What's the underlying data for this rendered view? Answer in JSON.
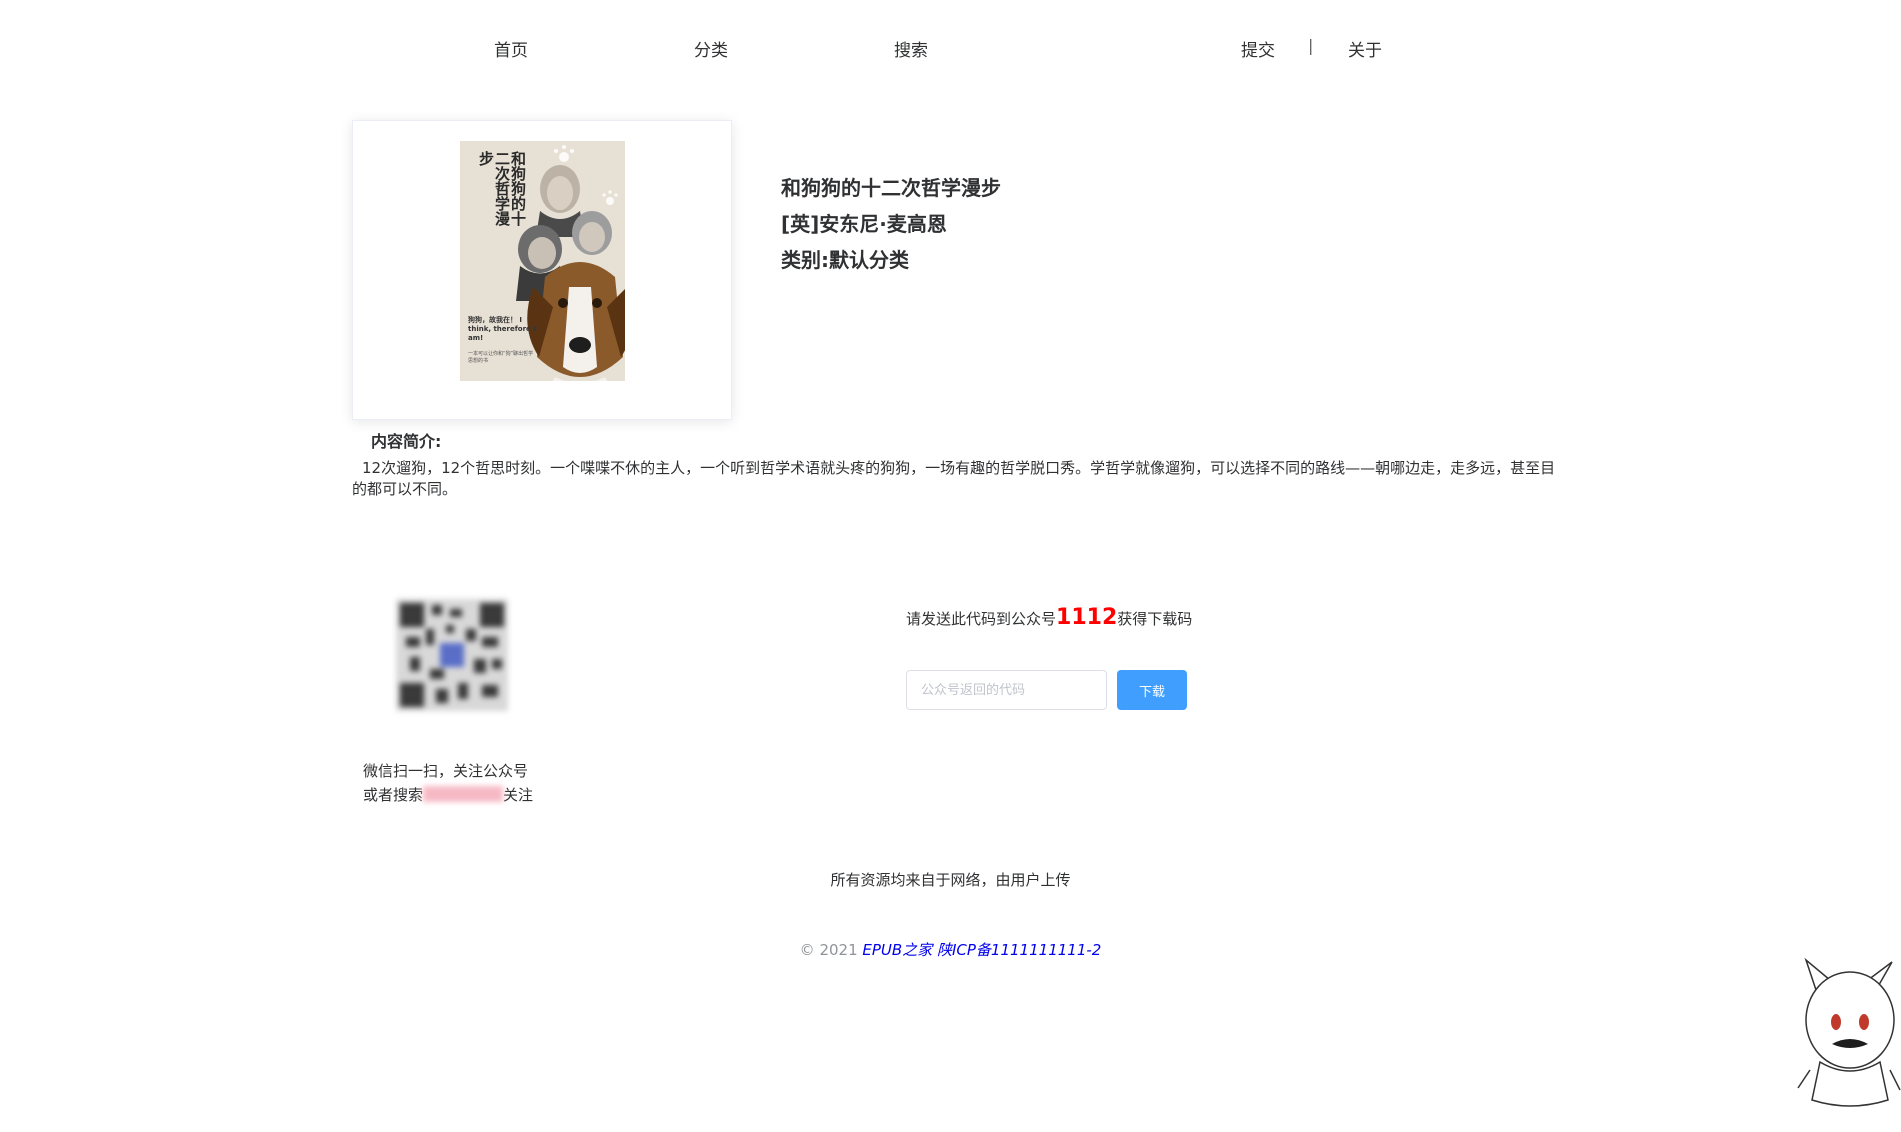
{
  "nav": {
    "home": "首页",
    "category": "分类",
    "search": "搜索",
    "submit": "提交",
    "divider": "|",
    "about": "关于"
  },
  "cover": {
    "title": "和狗狗的十二次哲学漫步",
    "tagline": "狗狗，故我在！ I think, therefore I am!",
    "subtitle": "一本可以让你和“狗”聊出哲学思想的书",
    "background_color": "#e7e0d5"
  },
  "book": {
    "title": "和狗狗的十二次哲学漫步",
    "author": "[英]安东尼·麦高恩",
    "category": "类别:默认分类"
  },
  "summary": {
    "label": "内容简介:",
    "text": "12次遛狗，12个哲思时刻。一个喋喋不休的主人，一个听到哲学术语就头疼的狗狗，一场有趣的哲学脱口秀。学哲学就像遛狗，可以选择不同的路线——朝哪边走，走多远，甚至目的都可以不同。"
  },
  "qr": {
    "caption_line1": "微信扫一扫，关注公众号",
    "caption_line2_prefix": "或者搜索",
    "caption_line2_suffix": "关注"
  },
  "download": {
    "instruction_prefix": "请发送此代码到公众号",
    "code": "1112",
    "instruction_suffix": "获得下载码",
    "input_placeholder": "公众号返回的代码",
    "input_value": "",
    "button_label": "下载"
  },
  "footer": {
    "note": "所有资源均来自于网络，由用户上传",
    "copyright_prefix": "© 2021",
    "site_name": "EPUB之家",
    "icp": "陕ICP备1111111111-2"
  },
  "colors": {
    "primary": "#409eff",
    "code": "#ff0000",
    "link": "#0000ee",
    "text": "#303133",
    "muted": "#909399"
  }
}
